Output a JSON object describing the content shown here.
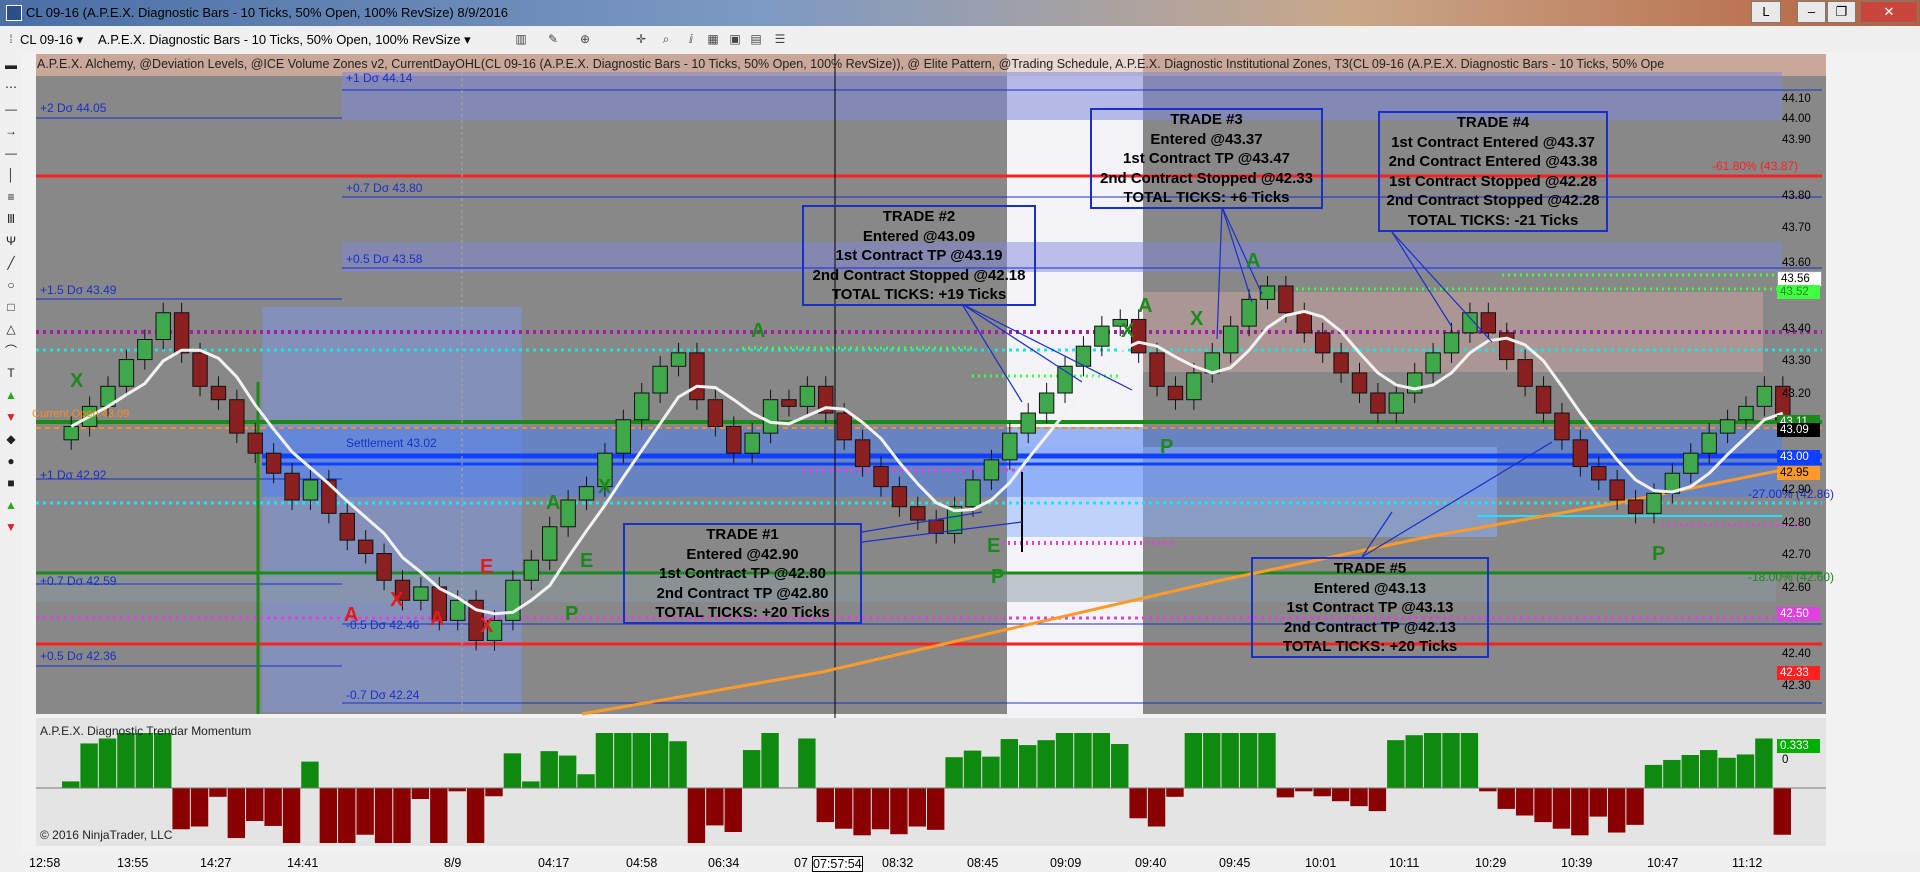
{
  "window": {
    "title": "CL 09-16 (A.P.E.X. Diagnostic Bars - 10 Ticks, 50% Open, 100% RevSize)  8/9/2016",
    "buttons": [
      "L"
    ]
  },
  "toolbar": {
    "instrument": "CL 09-16",
    "instrument_arrow": "▾",
    "bar_type": "A.P.E.X. Diagnostic Bars - 10 Ticks, 50% Open, 100% RevSize",
    "bar_type_arrow": "▾"
  },
  "indicator_header": "A.P.E.X. Alchemy, @Deviation Levels, @ICE Volume Zones v2, CurrentDayOHL(CL 09-16 (A.P.E.X. Diagnostic Bars - 10 Ticks, 50% Open, 100% RevSize)), @ Elite Pattern, @Trading Schedule, A.P.E.X. Diagnostic Institutional Zones, T3(CL 09-16 (A.P.E.X. Diagnostic Bars - 10 Ticks, 50% Ope",
  "deviation_labels": {
    "plus1_44_14": "+1 Dσ 44.14",
    "plus2_44_05": "+2 Dσ 44.05",
    "plus07_43_80": "+0.7 Dσ 43.80",
    "plus05_43_58": "+0.5 Dσ 43.58",
    "plus15_43_49": "+1.5 Dσ 43.49",
    "current_day_open": "Current Open 43.09",
    "settlement": "Settlement 43.02",
    "plus1_42_92": "+1 Dσ 42.92",
    "plus07_42_59": "+0.7 Dσ 42.59",
    "minus05_42_46": "-0.5 Dσ 42.46",
    "plus05_42_36": "+0.5 Dσ 42.36",
    "minus07_42_24": "-0.7 Dσ 42.24",
    "fib_618": "-61.80% (43.87)",
    "fib_27": "-27.00% (42.86)",
    "fib_18": "-18.00% (42.60)"
  },
  "price_axis": {
    "labels": [
      "44.10",
      "44.00",
      "43.90",
      "43.80",
      "43.70",
      "43.60",
      "43.40",
      "43.30",
      "43.20",
      "42.90",
      "42.80",
      "42.70",
      "42.60",
      "42.40",
      "42.30"
    ],
    "tags": {
      "t43_56": "43.56",
      "t43_52": "43.52",
      "t43_11": "43.11",
      "t43_09": "43.09",
      "t43_00": "43.00",
      "t42_95": "42.95",
      "t42_50": "42.50",
      "t42_33": "42.33"
    }
  },
  "trades": {
    "t1": [
      "TRADE #1",
      "Entered @42.90",
      "1st Contract TP @42.80",
      "2nd Contract TP @42.80",
      "TOTAL TICKS: +20 Ticks"
    ],
    "t2": [
      "TRADE #2",
      "Entered @43.09",
      "1st Contract TP @43.19",
      "2nd Contract Stopped @42.18",
      "TOTAL TICKS: +19 Ticks"
    ],
    "t3": [
      "TRADE #3",
      "Entered @43.37",
      "1st Contract TP @43.47",
      "2nd Contract Stopped @42.33",
      "TOTAL TICKS: +6 Ticks"
    ],
    "t4": [
      "TRADE #4",
      "1st Contract Entered @43.37",
      "2nd Contract Entered @43.38",
      "1st Contract Stopped @42.28",
      "2nd Contract Stopped @42.28",
      "TOTAL TICKS: -21 Ticks"
    ],
    "t5": [
      "TRADE #5",
      "Entered @43.13",
      "1st Contract TP @43.13",
      "2nd Contract TP @42.13",
      "TOTAL TICKS: +20 Ticks"
    ]
  },
  "signal_letters": {
    "x": "X",
    "a": "A",
    "e": "E",
    "p": "P"
  },
  "momentum_panel": {
    "title": "A.P.E.X. Diagnostic Trendar Momentum",
    "value_tag": "0.333",
    "zero_label": "0",
    "copyright": "© 2016 NinjaTrader, LLC"
  },
  "time_axis": [
    "12:58",
    "13:55",
    "14:27",
    "14:41",
    "8/9",
    "04:17",
    "04:58",
    "06:34",
    "07",
    "07:57:54",
    "08:32",
    "08:45",
    "09:09",
    "09:40",
    "09:45",
    "10:01",
    "10:11",
    "10:29",
    "10:39",
    "10:47",
    "11:12"
  ],
  "colors": {
    "chart_bg": "#8a8a8a",
    "volume_zone": "#6f8fe8",
    "bull_band": "#3fa84a",
    "bear_band": "#c85a5a",
    "trade_box_border": "#1a2fc9",
    "red_level": "#ff2020",
    "green_level": "#1a8a1a",
    "orange_t3": "#ff9a2a"
  },
  "chart_data": {
    "type": "candlestick",
    "title": "CL 09-16 (A.P.E.X. Diagnostic Bars - 10 Ticks, 50% Open, 100% RevSize)",
    "y_range": [
      42.22,
      44.14
    ],
    "closes": [
      43.08,
      43.14,
      43.2,
      43.28,
      43.34,
      43.42,
      43.3,
      43.2,
      43.16,
      43.06,
      43.0,
      42.94,
      42.86,
      42.92,
      42.82,
      42.74,
      42.7,
      42.62,
      42.56,
      42.6,
      42.5,
      42.56,
      42.44,
      42.5,
      42.62,
      42.68,
      42.78,
      42.86,
      42.9,
      43.0,
      43.1,
      43.18,
      43.26,
      43.3,
      43.16,
      43.08,
      43.0,
      43.06,
      43.16,
      43.14,
      43.2,
      43.12,
      43.04,
      42.96,
      42.9,
      42.84,
      42.8,
      42.76,
      42.84,
      42.92,
      42.98,
      43.06,
      43.12,
      43.18,
      43.26,
      43.32,
      43.38,
      43.4,
      43.3,
      43.2,
      43.16,
      43.24,
      43.3,
      43.38,
      43.46,
      43.5,
      43.42,
      43.36,
      43.3,
      43.24,
      43.18,
      43.12,
      43.18,
      43.24,
      43.3,
      43.36,
      43.42,
      43.36,
      43.28,
      43.2,
      43.12,
      43.04,
      42.96,
      42.92,
      42.86,
      42.82,
      42.88,
      42.94,
      43.0,
      43.06,
      43.1,
      43.14,
      43.2,
      43.1
    ],
    "momentum_range": [
      -0.4,
      0.4
    ]
  }
}
